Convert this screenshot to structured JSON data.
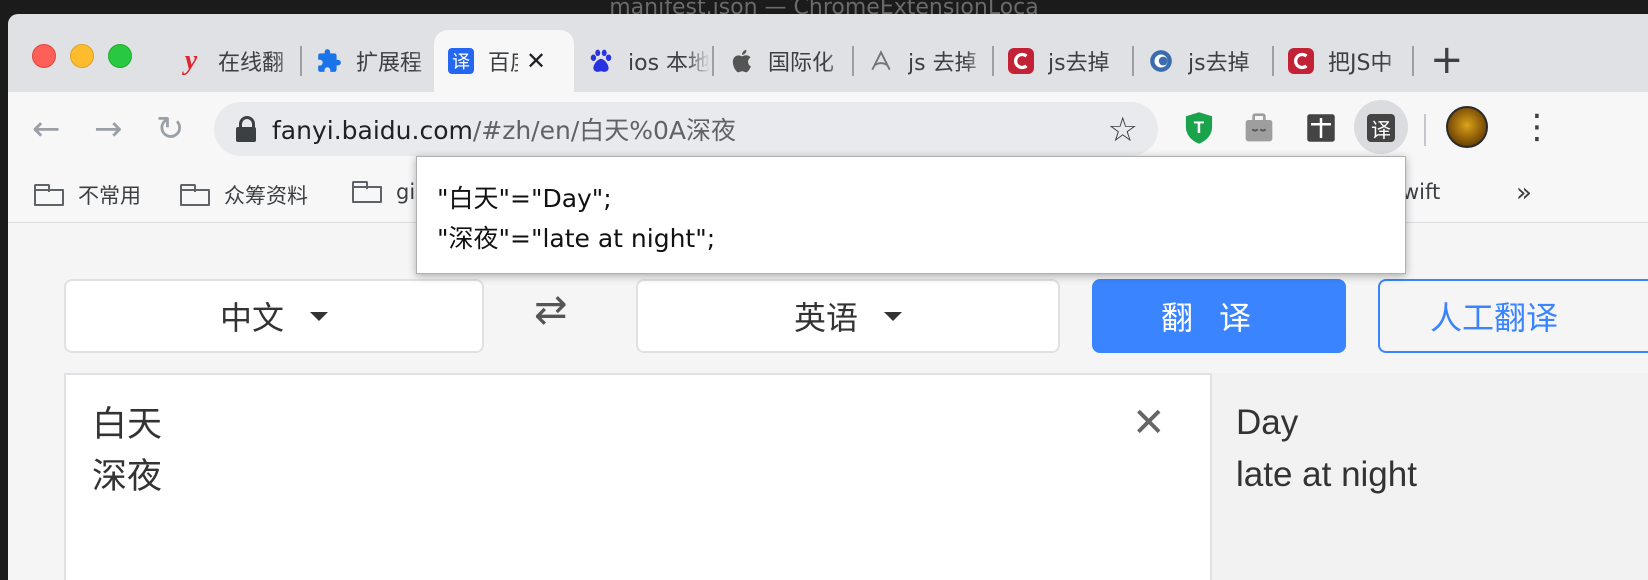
{
  "window": {
    "title": "manifest.json — ChromeExtensionLoca"
  },
  "tabs": [
    {
      "label": "在线翻",
      "icon": "youdao-icon"
    },
    {
      "label": "扩展程",
      "icon": "puzzle-icon"
    },
    {
      "label": "百度",
      "icon": "baidu-translate-icon",
      "active": true,
      "close": "✕"
    },
    {
      "label": "ios 本地",
      "icon": "baidu-paw-icon"
    },
    {
      "label": "国际化",
      "icon": "apple-icon"
    },
    {
      "label": "js 去掉",
      "icon": "stylus-icon"
    },
    {
      "label": "js去掉",
      "icon": "csdn-icon"
    },
    {
      "label": "js去掉",
      "icon": "cnblogs-icon"
    },
    {
      "label": "把JS中",
      "icon": "csdn-icon"
    }
  ],
  "toolbar": {
    "url_host": "fanyi.baidu.com",
    "url_path": "/#zh/en/白天%0A深夜",
    "ext_translate_label": "译"
  },
  "bookmarks": {
    "items": [
      "不常用",
      "众筹资料",
      "gi"
    ],
    "partial_right": "wift",
    "more": "»"
  },
  "popup": {
    "lines": [
      "\"白天\"=\"Day\";",
      "\"深夜\"=\"late at night\";"
    ]
  },
  "translator": {
    "source_lang": "中文",
    "target_lang": "英语",
    "swap": "⇄",
    "translate_btn": "翻译",
    "human_btn": "人工翻译",
    "source_lines": [
      "白天",
      "深夜"
    ],
    "result_lines": [
      "Day",
      "late at night"
    ],
    "clear": "✕"
  },
  "colors": {
    "accent": "#3a85ff",
    "tab_active_bg": "#f7f7f8"
  }
}
